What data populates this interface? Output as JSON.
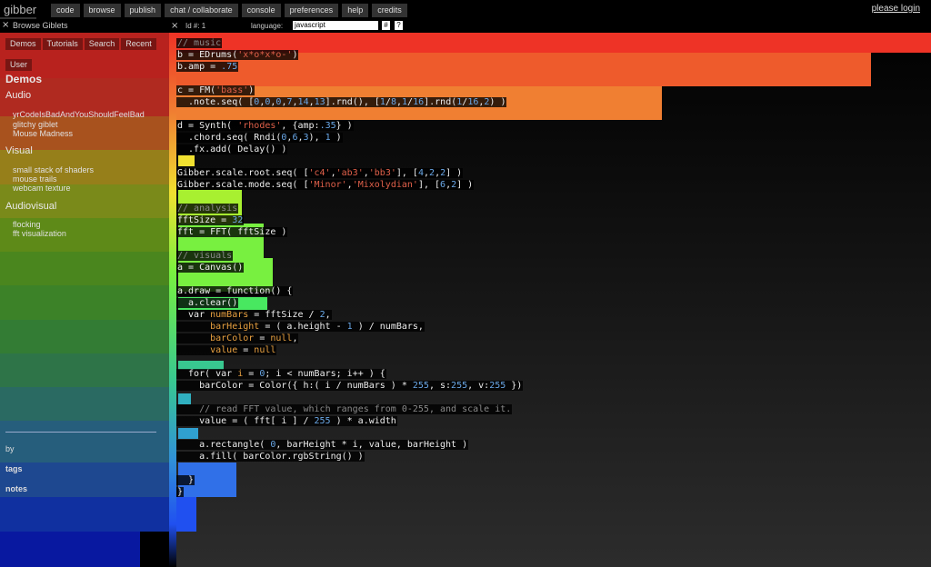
{
  "topbar": {
    "logo": "gibber",
    "nav": [
      "code",
      "browse",
      "publish",
      "chat / collaborate",
      "console",
      "preferences",
      "help",
      "credits"
    ],
    "login": "please login"
  },
  "sidebar": {
    "close": "×",
    "title": "Browse Giblets",
    "tabs": [
      "Demos",
      "Tutorials",
      "Search",
      "Recent",
      "User"
    ],
    "heading": "Demos",
    "categories": [
      {
        "name": "Audio",
        "items": [
          "yrCodeIsBadAndYouShouldFeelBad",
          "glitchy giblet",
          "Mouse Madness"
        ]
      },
      {
        "name": "Visual",
        "items": [
          "small stack of shaders",
          "mouse trails",
          "webcam texture"
        ]
      },
      {
        "name": "Audiovisual",
        "items": [
          "flocking",
          "fft visualization"
        ]
      }
    ],
    "meta": [
      "by",
      "tags",
      "notes"
    ]
  },
  "editor": {
    "close": "×",
    "id_label": "Id #: 1",
    "language_label": "language:",
    "language_value": "javascript",
    "btn_hash": "#",
    "btn_help": "?",
    "colors": [
      "#ee3326",
      "#ee5b2c",
      "#f07f32",
      "#f0a032",
      "#f0c030",
      "#f0e030",
      "#d8f030",
      "#a8f030",
      "#78f040",
      "#48e860",
      "#38c890",
      "#30b0c0",
      "#3090d8",
      "#3070e8",
      "#2050f0"
    ]
  }
}
